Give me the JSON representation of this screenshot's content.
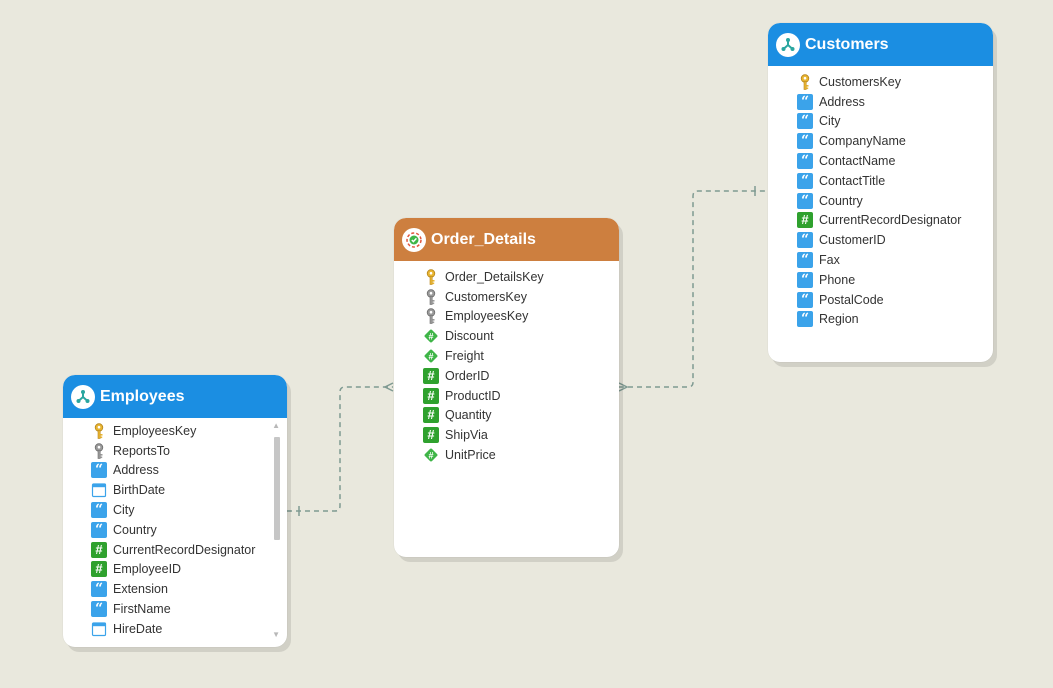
{
  "tables": {
    "customers": {
      "title": "Customers",
      "fields": [
        {
          "name": "CustomersKey",
          "icon": "primary-key-icon"
        },
        {
          "name": "Address",
          "icon": "string-field-icon"
        },
        {
          "name": "City",
          "icon": "string-field-icon"
        },
        {
          "name": "CompanyName",
          "icon": "string-field-icon"
        },
        {
          "name": "ContactName",
          "icon": "string-field-icon"
        },
        {
          "name": "ContactTitle",
          "icon": "string-field-icon"
        },
        {
          "name": "Country",
          "icon": "string-field-icon"
        },
        {
          "name": "CurrentRecordDesignator",
          "icon": "integer-field-icon"
        },
        {
          "name": "CustomerID",
          "icon": "string-field-icon"
        },
        {
          "name": "Fax",
          "icon": "string-field-icon"
        },
        {
          "name": "Phone",
          "icon": "string-field-icon"
        },
        {
          "name": "PostalCode",
          "icon": "string-field-icon"
        },
        {
          "name": "Region",
          "icon": "string-field-icon"
        }
      ]
    },
    "order_details": {
      "title": "Order_Details",
      "fields": [
        {
          "name": "Order_DetailsKey",
          "icon": "primary-key-icon"
        },
        {
          "name": "CustomersKey",
          "icon": "foreign-key-icon"
        },
        {
          "name": "EmployeesKey",
          "icon": "foreign-key-icon"
        },
        {
          "name": "Discount",
          "icon": "decimal-field-icon"
        },
        {
          "name": "Freight",
          "icon": "decimal-field-icon"
        },
        {
          "name": "OrderID",
          "icon": "integer-field-icon"
        },
        {
          "name": "ProductID",
          "icon": "integer-field-icon"
        },
        {
          "name": "Quantity",
          "icon": "integer-field-icon"
        },
        {
          "name": "ShipVia",
          "icon": "integer-field-icon"
        },
        {
          "name": "UnitPrice",
          "icon": "decimal-field-icon"
        }
      ]
    },
    "employees": {
      "title": "Employees",
      "fields": [
        {
          "name": "EmployeesKey",
          "icon": "primary-key-icon"
        },
        {
          "name": "ReportsTo",
          "icon": "foreign-key-icon"
        },
        {
          "name": "Address",
          "icon": "string-field-icon"
        },
        {
          "name": "BirthDate",
          "icon": "date-field-icon"
        },
        {
          "name": "City",
          "icon": "string-field-icon"
        },
        {
          "name": "Country",
          "icon": "string-field-icon"
        },
        {
          "name": "CurrentRecordDesignator",
          "icon": "integer-field-icon"
        },
        {
          "name": "EmployeeID",
          "icon": "integer-field-icon"
        },
        {
          "name": "Extension",
          "icon": "string-field-icon"
        },
        {
          "name": "FirstName",
          "icon": "string-field-icon"
        },
        {
          "name": "HireDate",
          "icon": "date-field-icon"
        }
      ]
    }
  },
  "colors": {
    "dimension_header": "#1b8ee2",
    "fact_header": "#cd7f3f",
    "string_icon": "#3ba3ea",
    "integer_icon": "#2fa12e",
    "decimal_icon": "#3fb548",
    "key_icon": "#e8b532",
    "foreign_key_icon": "#8c8c8c",
    "connector": "#7f9a92",
    "background": "#e9e8dd"
  }
}
